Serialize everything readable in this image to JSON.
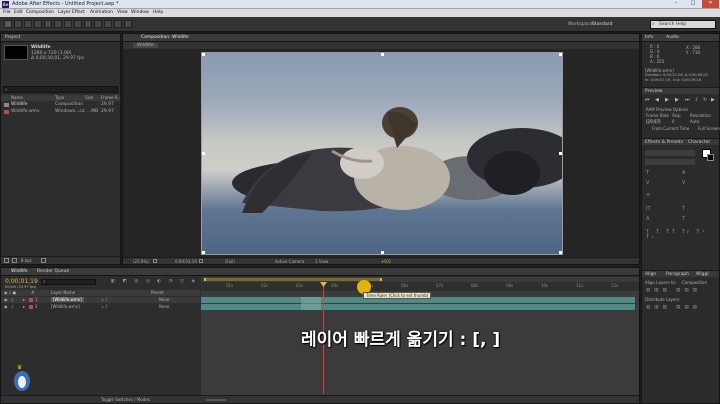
{
  "window": {
    "title": "Adobe After Effects - Untitled Project.aep *",
    "controls": [
      "–",
      "□",
      "✕"
    ],
    "menu": [
      "File",
      "Edit",
      "Composition",
      "Layer",
      "Effect",
      "Animation",
      "View",
      "Window",
      "Help"
    ]
  },
  "toolbar": {
    "workspace_label": "Workspace:",
    "workspace_value": "Standard",
    "search_placeholder": "Search Help"
  },
  "project": {
    "tab": "Project",
    "comp_name": "Wildlife",
    "comp_info_1": "1280 x 720 (1.00)",
    "comp_info_2": "Δ 0;00;30;01, 29.97 fps",
    "columns": [
      "Name",
      "Type",
      "Size",
      "Frame R..."
    ],
    "items": [
      {
        "name": "Wildlife",
        "type": "Composition",
        "fps": "29.97"
      },
      {
        "name": "Wildlife.wmv",
        "type": "Windows...ca",
        "size": "...MB",
        "fps": "29.97"
      }
    ],
    "bpc": "8 bpc"
  },
  "composition": {
    "tab": "Composition: Wildlife",
    "subtab": "Wildlife",
    "zoom": "(25.9%)",
    "timecode": "0;00;01;19",
    "resolution": "(Full)",
    "camera": "Active Camera",
    "views": "1 View",
    "exposure": "+0.0"
  },
  "info": {
    "tabs": [
      "Info",
      "Audio"
    ],
    "r": "R : 0",
    "g": "G : 0",
    "b": "B : 0",
    "a": "A : 255",
    "x": "X : 286",
    "y": "Y : 718",
    "file": "[Wildlife.wmv]",
    "duration": "Duration: 0;00;22;28, Δ 0;00;00;02",
    "in": "In: 0;00;01;19, Out: 0;00;29;16"
  },
  "preview": {
    "tab": "Preview",
    "ram_options": "RAM Preview Options",
    "frame_rate_label": "Frame Rate",
    "skip_label": "Skip",
    "resolution_label": "Resolution",
    "frame_rate": "(29.97)",
    "skip": "0",
    "resolution": "Auto",
    "from_current": "From Current Time",
    "full_screen": "Full Screen"
  },
  "effects": {
    "tabs": [
      "Effects & Presets",
      "Character"
    ]
  },
  "align": {
    "tabs": [
      "Align",
      "Paragraph",
      "Wiggl"
    ],
    "align_to": "Align Layers to:",
    "align_value": "Composition",
    "distribute": "Distribute Layers:"
  },
  "timeline": {
    "tabs": [
      "Wildlife",
      "Render Queue"
    ],
    "timecode": "0;00;01;19",
    "frames": "00049 (29.97 fps)",
    "columns": [
      "#",
      "Layer Name",
      "Parent"
    ],
    "layers": [
      {
        "num": "1",
        "name": "[Wildlife.wmv]",
        "parent": "None"
      },
      {
        "num": "2",
        "name": "[Wildlife.wmv]",
        "parent": "None"
      }
    ],
    "ruler_marks": [
      "01s",
      "02s",
      "03s",
      "04s",
      "05s",
      "06s",
      "07s",
      "08s",
      "09s",
      "10s",
      "11s",
      "12s",
      "13s",
      "14s",
      "15s",
      "16s",
      "17s",
      "18s",
      "19s",
      "20s"
    ],
    "tooltip": "Time Ruler (Click to set thumb)",
    "toggle": "Toggle Switches / Modes"
  },
  "caption": "레이어 빠르게 옮기기 : [, ]",
  "colors": {
    "accent_yellow": "#f5c400",
    "playhead_red": "#e13a3a",
    "layer_bar": "#4f8b86"
  }
}
